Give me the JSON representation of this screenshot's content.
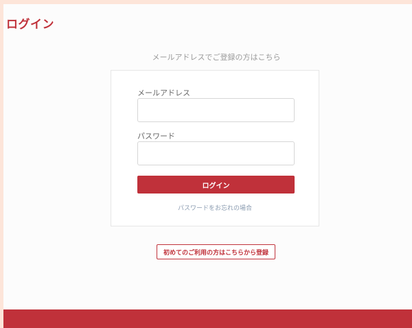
{
  "page": {
    "title": "ログイン",
    "subtitle": "メールアドレスでご登録の方はこちら"
  },
  "form": {
    "email_label": "メールアドレス",
    "email_value": "",
    "password_label": "パスワード",
    "password_value": "",
    "login_button": "ログイン",
    "forgot_link": "パスワードをお忘れの場合"
  },
  "register": {
    "button_label": "初めてのご利用の方はこちらから登録"
  },
  "colors": {
    "accent": "#c0313a",
    "outer_background": "#fde5d9",
    "page_background": "#fcfcfc"
  }
}
